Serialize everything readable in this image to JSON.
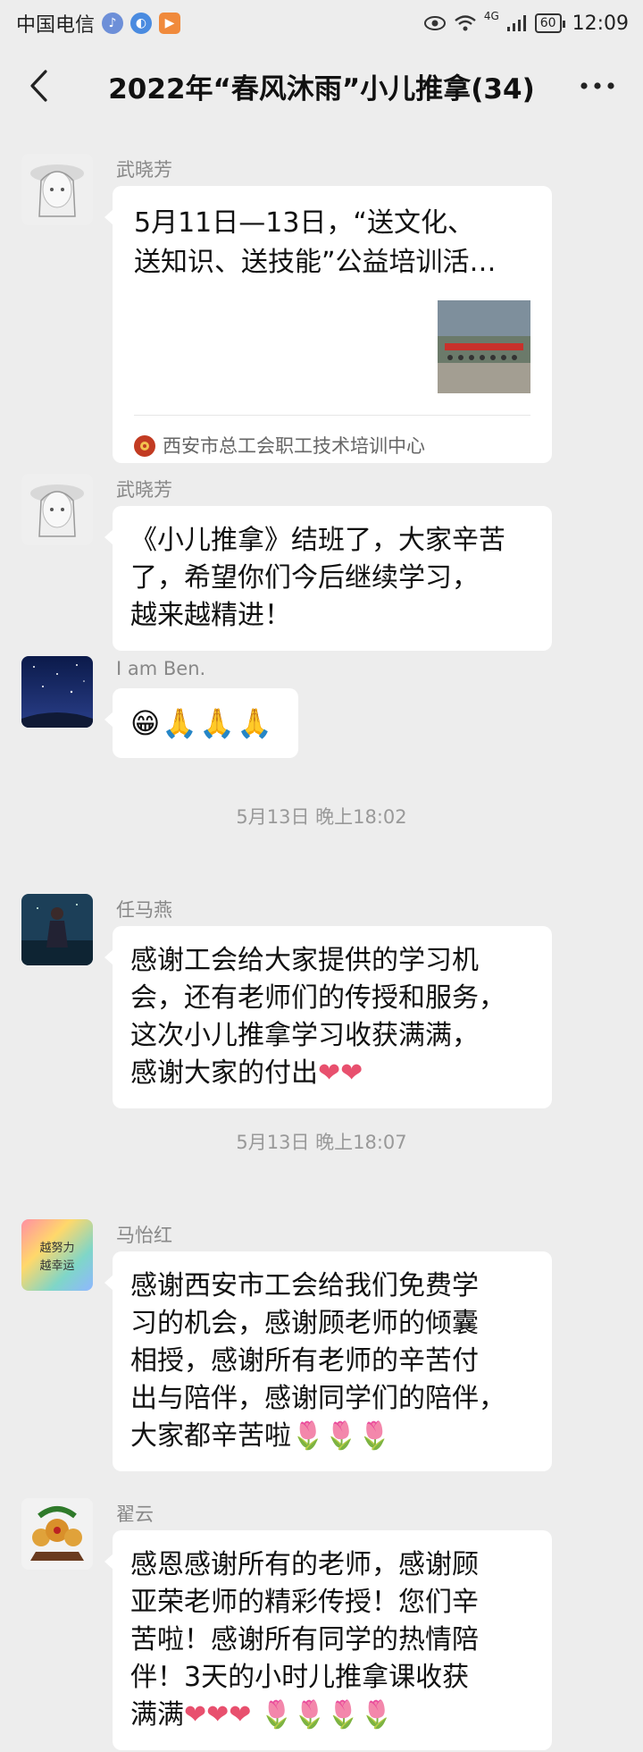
{
  "status_bar": {
    "carrier": "中国电信",
    "signal_label": "4G",
    "battery": "60",
    "time": "12:09"
  },
  "nav": {
    "title": "2022年“春风沐雨”小儿推拿(34)",
    "back_icon": "chevron-left-icon",
    "more_icon": "more-icon"
  },
  "messages": [
    {
      "sender": "武晓芳",
      "type": "card",
      "title": "5月11日—13日，“送文化、送知识、送技能”公益培训活…",
      "title_line1": "5月11日—13日，“送文化、",
      "title_line2": "送知识、送技能”公益培训活…",
      "source": "西安市总工会职工技术培训中心"
    },
    {
      "sender": "武晓芳",
      "type": "text",
      "line1": "《小儿推拿》结班了，大家辛苦",
      "line2": "了，希望你们今后继续学习，",
      "line3": "越来越精进！"
    },
    {
      "sender": "I am Ben.",
      "type": "emoji",
      "emoji": "😁🙏🙏🙏"
    },
    {
      "timestamp": "5月13日 晚上18:02"
    },
    {
      "sender": "任马燕",
      "type": "text",
      "line1": "感谢工会给大家提供的学习机",
      "line2": "会，还有老师们的传授和服务，",
      "line3": "这次小儿推拿学习收获满满，",
      "line4": "感谢大家的付出",
      "emoji": "❤❤"
    },
    {
      "timestamp": "5月13日 晚上18:07"
    },
    {
      "sender": "马怡红",
      "type": "text",
      "line1": "感谢西安市工会给我们免费学",
      "line2": "习的机会，感谢顾老师的倾囊",
      "line3": "相授，感谢所有老师的辛苦付",
      "line4": "出与陪伴，感谢同学们的陪伴，",
      "line5": "大家都辛苦啦",
      "emoji": "🌷🌷🌷"
    },
    {
      "sender": "翟云",
      "type": "text",
      "line1": "感恩感谢所有的老师，感谢顾",
      "line2": "亚荣老师的精彩传授！您们辛",
      "line3": "苦啦！感谢所有同学的热情陪",
      "line4": "伴！3天的小时儿推拿课收获",
      "line5": "满满",
      "hearts": "❤❤❤",
      "roses": "🌷🌷🌷🌷"
    }
  ],
  "avatar_texts": {
    "mayihong": "越努力越幸运"
  },
  "colors": {
    "background": "#ededed",
    "bubble": "#ffffff",
    "meta_text": "#888888"
  }
}
